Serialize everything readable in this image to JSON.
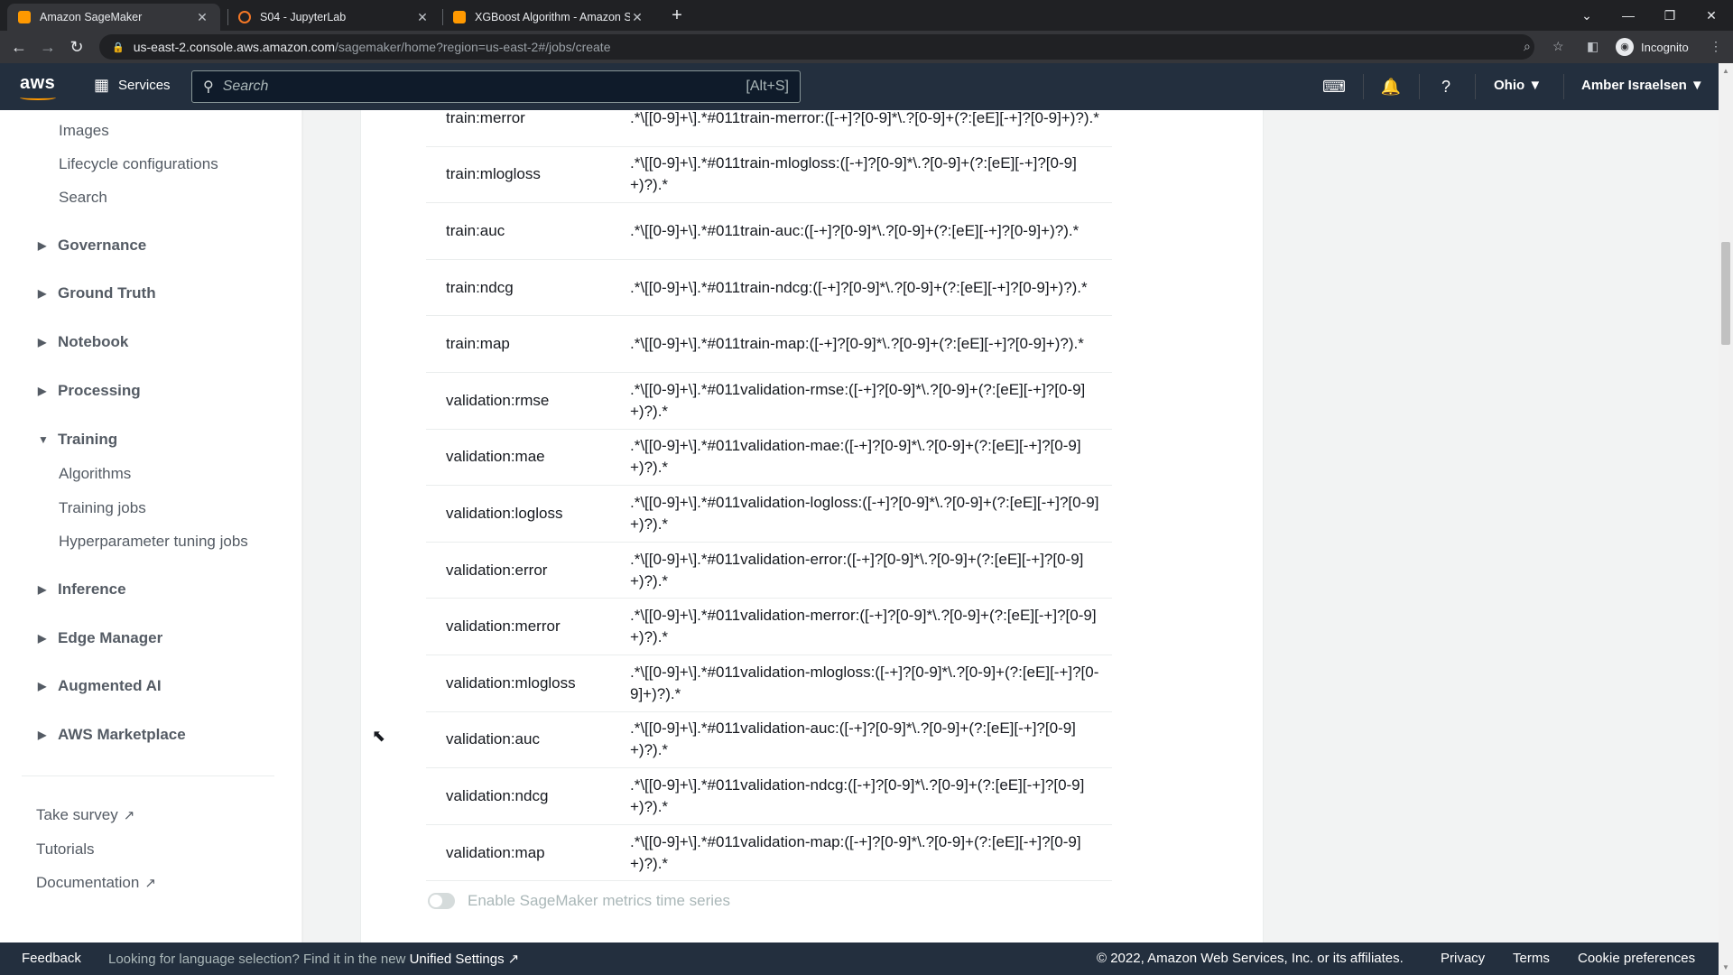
{
  "browser": {
    "tabs": [
      {
        "title": "Amazon SageMaker",
        "active": true,
        "favicon_color": "#ff9900"
      },
      {
        "title": "S04 - JupyterLab",
        "active": false,
        "favicon_color": "#f37726"
      },
      {
        "title": "XGBoost Algorithm - Amazon Sa",
        "active": false,
        "favicon_color": "#ff9900"
      }
    ],
    "new_tab": "+",
    "url_host": "us-east-2.console.aws.amazon.com",
    "url_path": "/sagemaker/home?region=us-east-2#/jobs/create",
    "incognito_label": "Incognito"
  },
  "aws_nav": {
    "logo": "aws",
    "services_label": "Services",
    "search_placeholder": "Search",
    "search_shortcut": "[Alt+S]",
    "region": "Ohio ▼",
    "user": "Amber Israelsen ▼"
  },
  "sidebar": {
    "top_items": [
      "Images",
      "Lifecycle configurations",
      "Search"
    ],
    "sections": [
      {
        "label": "Governance",
        "expanded": false
      },
      {
        "label": "Ground Truth",
        "expanded": false
      },
      {
        "label": "Notebook",
        "expanded": false
      },
      {
        "label": "Processing",
        "expanded": false
      },
      {
        "label": "Training",
        "expanded": true
      },
      {
        "label": "Inference",
        "expanded": false
      },
      {
        "label": "Edge Manager",
        "expanded": false
      },
      {
        "label": "Augmented AI",
        "expanded": false
      },
      {
        "label": "AWS Marketplace",
        "expanded": false
      }
    ],
    "training_items": [
      "Algorithms",
      "Training jobs",
      "Hyperparameter tuning jobs"
    ],
    "footer_links": [
      {
        "label": "Take survey",
        "external": true
      },
      {
        "label": "Tutorials",
        "external": false
      },
      {
        "label": "Documentation",
        "external": true
      }
    ]
  },
  "metrics": [
    {
      "name": "train:merror",
      "regex": ".*\\[[0-9]+\\].*#011train-merror:([-+]?[0-9]*\\.?[0-9]+(?:[eE][-+]?[0-9]+)?).*"
    },
    {
      "name": "train:mlogloss",
      "regex": ".*\\[[0-9]+\\].*#011train-mlogloss:([-+]?[0-9]*\\.?[0-9]+(?:[eE][-+]?[0-9]+)?).*"
    },
    {
      "name": "train:auc",
      "regex": ".*\\[[0-9]+\\].*#011train-auc:([-+]?[0-9]*\\.?[0-9]+(?:[eE][-+]?[0-9]+)?).*"
    },
    {
      "name": "train:ndcg",
      "regex": ".*\\[[0-9]+\\].*#011train-ndcg:([-+]?[0-9]*\\.?[0-9]+(?:[eE][-+]?[0-9]+)?).*"
    },
    {
      "name": "train:map",
      "regex": ".*\\[[0-9]+\\].*#011train-map:([-+]?[0-9]*\\.?[0-9]+(?:[eE][-+]?[0-9]+)?).*"
    },
    {
      "name": "validation:rmse",
      "regex": ".*\\[[0-9]+\\].*#011validation-rmse:([-+]?[0-9]*\\.?[0-9]+(?:[eE][-+]?[0-9]+)?).*"
    },
    {
      "name": "validation:mae",
      "regex": ".*\\[[0-9]+\\].*#011validation-mae:([-+]?[0-9]*\\.?[0-9]+(?:[eE][-+]?[0-9]+)?).*"
    },
    {
      "name": "validation:logloss",
      "regex": ".*\\[[0-9]+\\].*#011validation-logloss:([-+]?[0-9]*\\.?[0-9]+(?:[eE][-+]?[0-9]+)?).*"
    },
    {
      "name": "validation:error",
      "regex": ".*\\[[0-9]+\\].*#011validation-error:([-+]?[0-9]*\\.?[0-9]+(?:[eE][-+]?[0-9]+)?).*"
    },
    {
      "name": "validation:merror",
      "regex": ".*\\[[0-9]+\\].*#011validation-merror:([-+]?[0-9]*\\.?[0-9]+(?:[eE][-+]?[0-9]+)?).*"
    },
    {
      "name": "validation:mlogloss",
      "regex": ".*\\[[0-9]+\\].*#011validation-mlogloss:([-+]?[0-9]*\\.?[0-9]+(?:[eE][-+]?[0-9]+)?).*"
    },
    {
      "name": "validation:auc",
      "regex": ".*\\[[0-9]+\\].*#011validation-auc:([-+]?[0-9]*\\.?[0-9]+(?:[eE][-+]?[0-9]+)?).*"
    },
    {
      "name": "validation:ndcg",
      "regex": ".*\\[[0-9]+\\].*#011validation-ndcg:([-+]?[0-9]*\\.?[0-9]+(?:[eE][-+]?[0-9]+)?).*"
    },
    {
      "name": "validation:map",
      "regex": ".*\\[[0-9]+\\].*#011validation-map:([-+]?[0-9]*\\.?[0-9]+(?:[eE][-+]?[0-9]+)?).*"
    }
  ],
  "time_series_toggle": {
    "label": "Enable SageMaker metrics time series",
    "enabled": false
  },
  "footer": {
    "feedback": "Feedback",
    "language_msg": "Looking for language selection? Find it in the new",
    "unified_settings": "Unified Settings",
    "copyright": "© 2022, Amazon Web Services, Inc. or its affiliates.",
    "privacy": "Privacy",
    "terms": "Terms",
    "cookie_prefs": "Cookie preferences"
  },
  "colors": {
    "aws_nav_bg": "#232f3e",
    "aws_orange": "#ff9900",
    "browser_bg": "#202124"
  }
}
